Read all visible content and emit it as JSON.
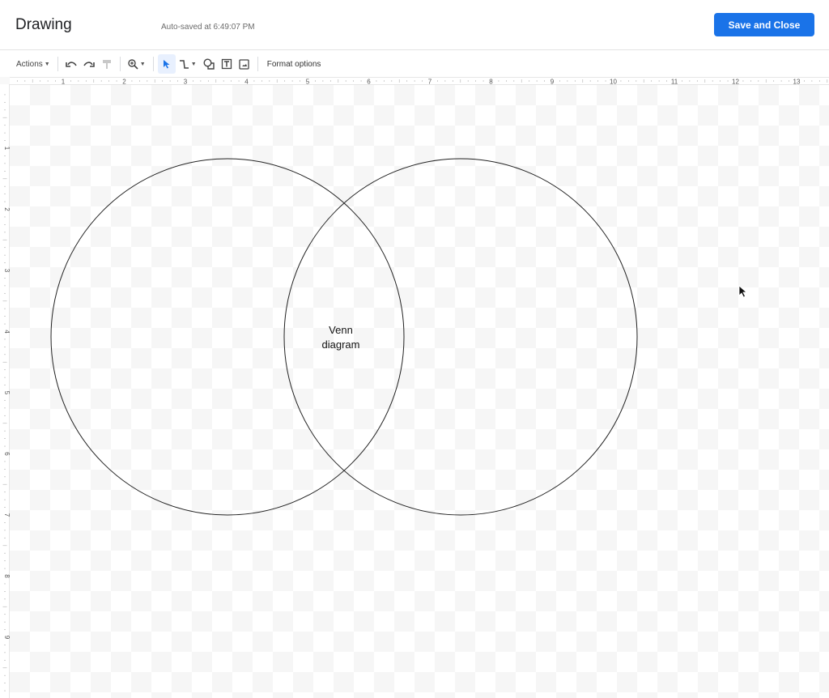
{
  "header": {
    "title": "Drawing",
    "autosave_status": "Auto-saved at 6:49:07 PM",
    "save_close_label": "Save and Close",
    "accent_color": "#1a73e8"
  },
  "toolbar": {
    "actions_label": "Actions",
    "items": [
      {
        "name": "undo",
        "icon": "undo-icon"
      },
      {
        "name": "redo",
        "icon": "redo-icon"
      },
      {
        "name": "paint-format",
        "icon": "paint-format-icon",
        "disabled": true
      },
      {
        "name": "zoom",
        "icon": "zoom-in-icon",
        "dropdown": true
      },
      {
        "name": "select",
        "icon": "select-arrow-icon",
        "active": true
      },
      {
        "name": "line",
        "icon": "line-icon",
        "dropdown": true
      },
      {
        "name": "shape",
        "icon": "shape-icon"
      },
      {
        "name": "text-box",
        "icon": "text-box-icon"
      },
      {
        "name": "image",
        "icon": "image-icon"
      }
    ],
    "format_options_label": "Format options"
  },
  "rulers": {
    "horizontal": [
      "1",
      "2",
      "3",
      "4",
      "5",
      "6",
      "7",
      "8",
      "9",
      "10",
      "11",
      "12",
      "13"
    ],
    "vertical": [
      "1",
      "2",
      "3",
      "4",
      "5",
      "6",
      "7",
      "8",
      "9"
    ]
  },
  "canvas": {
    "shapes": [
      {
        "type": "circle",
        "name": "left-circle",
        "stroke": "#222222"
      },
      {
        "type": "circle",
        "name": "right-circle",
        "stroke": "#222222"
      }
    ],
    "text_box": {
      "line1": "Venn",
      "line2": "diagram"
    }
  }
}
